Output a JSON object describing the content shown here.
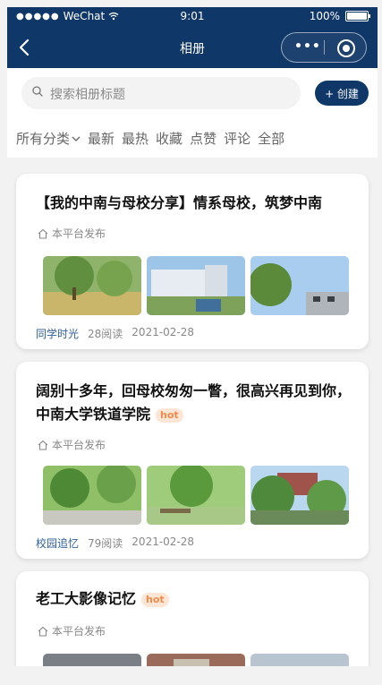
{
  "status_bar": {
    "carrier": "WeChat",
    "time": "9:01",
    "battery_pct": "100%"
  },
  "nav": {
    "title": "相册"
  },
  "search": {
    "placeholder": "搜索相册标题",
    "create_label": "+ 创建"
  },
  "tabs": [
    {
      "label": "所有分类"
    },
    {
      "label": "最新"
    },
    {
      "label": "最热"
    },
    {
      "label": "收藏"
    },
    {
      "label": "点赞"
    },
    {
      "label": "评论"
    },
    {
      "label": "全部"
    }
  ],
  "colors": {
    "nav_bg": "#0f3768",
    "hot_bg": "#fde6d6",
    "hot_text": "#f08a4b",
    "category": "#2e5f9b"
  },
  "cards": [
    {
      "title": "【我的中南与母校分享】情系母校，筑梦中南",
      "publisher": "本平台发布",
      "category": "同学时光",
      "reads": "28阅读",
      "date": "2021-02-28"
    },
    {
      "title": "阔别十多年，回母校匆匆一瞥，很高兴再见到你，中南大学铁道学院",
      "hot": "hot",
      "publisher": "本平台发布",
      "category": "校园追忆",
      "reads": "79阅读",
      "date": "2021-02-28"
    },
    {
      "title": "老工大影像记忆",
      "hot": "hot",
      "publisher": "本平台发布"
    }
  ]
}
